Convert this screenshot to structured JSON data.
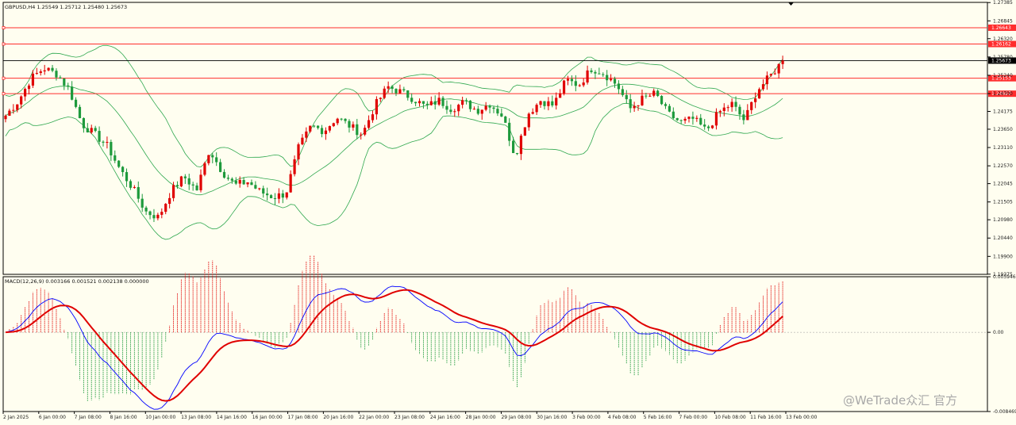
{
  "header": {
    "symbol": "GBPUSD,H4",
    "ohlc": "1.25549 1.25712 1.25480 1.25673"
  },
  "macd_header": {
    "label": "MACD(12,26,9) 0.003166 0.001521 0.002138 0.000000"
  },
  "watermark": "@WeTrade众汇 官方",
  "colors": {
    "background": "#fffef0",
    "bull": "#e00000",
    "bear": "#1e9a3c",
    "bollinger": "#2fa84f",
    "level_line": "#ff2d2d",
    "macd_line": "#0000ff",
    "signal_line": "#e00000"
  },
  "chart_data": [
    {
      "type": "candlestick",
      "symbol": "GBPUSD",
      "timeframe": "H4",
      "ylim": [
        1.1937,
        1.2739
      ],
      "y_ticks": [
        "1.27385",
        "1.26845",
        "1.26320",
        "1.25780",
        "1.25240",
        "1.24700",
        "1.24175",
        "1.23650",
        "1.23110",
        "1.22570",
        "1.22045",
        "1.21505",
        "1.20980",
        "1.20440",
        "1.19900",
        "1.19375"
      ],
      "x_ticks": [
        "2 Jan 2025",
        "6 Jan 00:00",
        "7 Jan 08:00",
        "8 Jan 16:00",
        "10 Jan 00:00",
        "13 Jan 08:00",
        "14 Jan 16:00",
        "16 Jan 00:00",
        "17 Jan 08:00",
        "20 Jan 16:00",
        "22 Jan 00:00",
        "23 Jan 08:00",
        "24 Jan 16:00",
        "28 Jan 00:00",
        "29 Jan 08:00",
        "30 Jan 16:00",
        "3 Feb 00:00",
        "4 Feb 08:00",
        "5 Feb 16:00",
        "7 Feb 00:00",
        "10 Feb 08:00",
        "11 Feb 16:00",
        "13 Feb 00:00"
      ],
      "current_price": "1.25673",
      "levels": [
        {
          "label": "1.26643",
          "value": 1.26643
        },
        {
          "label": "1.26162",
          "value": 1.26162
        },
        {
          "label": "1.25153",
          "value": 1.25153
        },
        {
          "label": "1.24697",
          "value": 1.24697
        }
      ],
      "indicators": [
        "Bollinger Bands"
      ],
      "close_path": [
        1.2405,
        1.2448,
        1.2515,
        1.2545,
        1.2528,
        1.2482,
        1.238,
        1.235,
        1.2315,
        1.2245,
        1.219,
        1.2122,
        1.2105,
        1.2182,
        1.2225,
        1.2185,
        1.2305,
        1.224,
        1.22,
        1.221,
        1.218,
        1.2165,
        1.2175,
        1.231,
        1.2375,
        1.236,
        1.24,
        1.2375,
        1.235,
        1.2435,
        1.249,
        1.2475,
        1.2455,
        1.243,
        1.245,
        1.2425,
        1.2445,
        1.242,
        1.244,
        1.2405,
        1.2285,
        1.241,
        1.245,
        1.2435,
        1.251,
        1.2495,
        1.2545,
        1.2528,
        1.2495,
        1.2425,
        1.2455,
        1.247,
        1.241,
        1.2385,
        1.2395,
        1.236,
        1.2415,
        1.244,
        1.239,
        1.248,
        1.252,
        1.2567
      ]
    },
    {
      "type": "macd",
      "params": "12,26,9",
      "values": {
        "macd": 0.003166,
        "signal": 0.001521,
        "histogram": 0.002138,
        "zero": 0.0
      },
      "ylim": [
        -0.008469,
        0.005946
      ],
      "y_ticks": [
        "0.005946",
        "0.00",
        "-0.008469"
      ]
    }
  ]
}
